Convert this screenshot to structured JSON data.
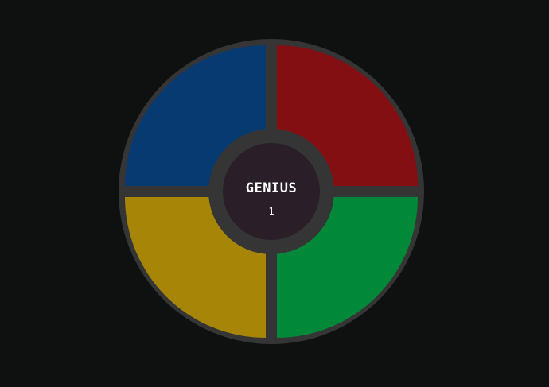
{
  "game": {
    "title": "GENIUS",
    "score": "1"
  },
  "pads": {
    "top_left": {
      "name": "blue",
      "color": "#083a72"
    },
    "top_right": {
      "name": "red",
      "color": "#830f13"
    },
    "bottom_left": {
      "name": "yellow",
      "color": "#a78506"
    },
    "bottom_right": {
      "name": "green",
      "color": "#018839"
    }
  }
}
